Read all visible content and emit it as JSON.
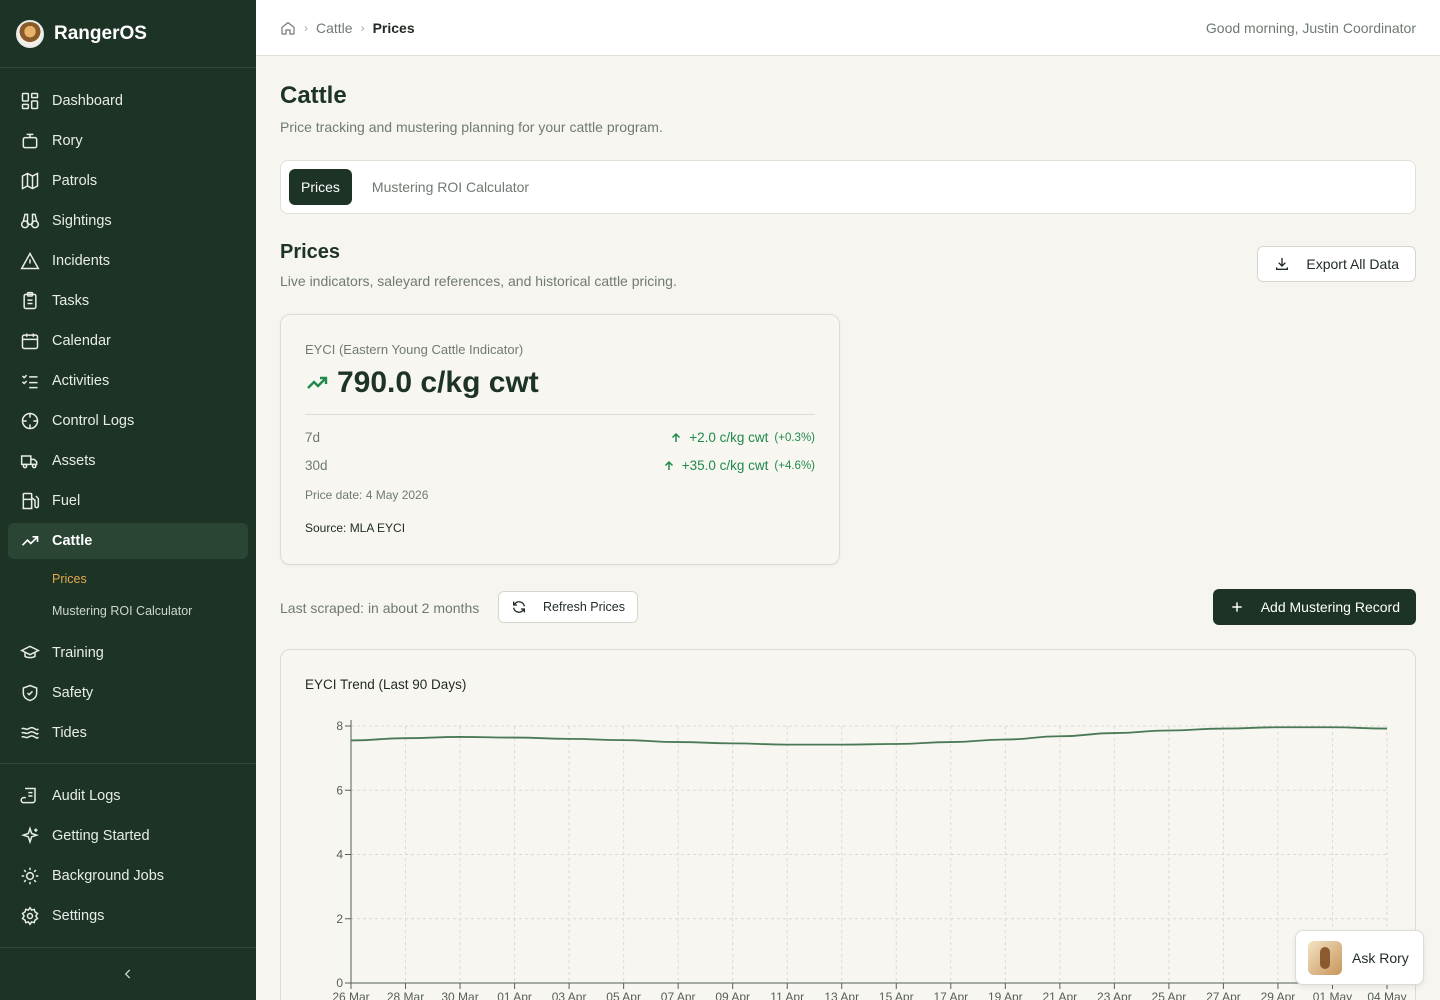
{
  "app": {
    "name": "RangerOS"
  },
  "nav": {
    "items": [
      {
        "label": "Dashboard",
        "icon": "dashboard-icon"
      },
      {
        "label": "Rory",
        "icon": "bot-icon"
      },
      {
        "label": "Patrols",
        "icon": "map-icon"
      },
      {
        "label": "Sightings",
        "icon": "binoculars-icon"
      },
      {
        "label": "Incidents",
        "icon": "alert-triangle-icon"
      },
      {
        "label": "Tasks",
        "icon": "clipboard-icon"
      },
      {
        "label": "Calendar",
        "icon": "calendar-icon"
      },
      {
        "label": "Activities",
        "icon": "list-checks-icon"
      },
      {
        "label": "Control Logs",
        "icon": "crosshair-icon"
      },
      {
        "label": "Assets",
        "icon": "truck-icon"
      },
      {
        "label": "Fuel",
        "icon": "fuel-icon"
      },
      {
        "label": "Cattle",
        "icon": "trending-up-icon",
        "active": true
      }
    ],
    "cattle_sub": [
      "Prices",
      "Mustering ROI Calculator"
    ],
    "items_after": [
      {
        "label": "Training",
        "icon": "graduation-cap-icon"
      },
      {
        "label": "Safety",
        "icon": "shield-check-icon"
      },
      {
        "label": "Tides",
        "icon": "waves-icon"
      }
    ],
    "admin": [
      {
        "label": "Audit Logs",
        "icon": "scroll-icon"
      },
      {
        "label": "Getting Started",
        "icon": "sparkles-icon"
      },
      {
        "label": "Background Jobs",
        "icon": "cog-icon"
      },
      {
        "label": "Settings",
        "icon": "settings-icon"
      }
    ]
  },
  "topbar": {
    "breadcrumb": [
      "Cattle",
      "Prices"
    ],
    "greeting": "Good morning, Justin Coordinator"
  },
  "page": {
    "title": "Cattle",
    "subtitle": "Price tracking and mustering planning for your cattle program.",
    "tabs": [
      {
        "label": "Prices",
        "active": true
      },
      {
        "label": "Mustering ROI Calculator",
        "active": false
      }
    ]
  },
  "prices": {
    "title": "Prices",
    "subtitle": "Live indicators, saleyard references, and historical cattle pricing.",
    "export_label": "Export All Data",
    "card": {
      "label": "EYCI (Eastern Young Cattle Indicator)",
      "value": "790.0 c/kg cwt",
      "rows": [
        {
          "period": "7d",
          "delta": "+2.0 c/kg cwt",
          "pct": "(+0.3%)"
        },
        {
          "period": "30d",
          "delta": "+35.0 c/kg cwt",
          "pct": "(+4.6%)"
        }
      ],
      "price_date": "Price date: 4 May 2026",
      "source": "Source: MLA EYCI"
    },
    "last_scraped": "Last scraped: in about 2 months",
    "refresh_label": "Refresh Prices",
    "add_label": "Add Mustering Record"
  },
  "chart_data": {
    "type": "line",
    "title": "EYCI Trend (Last 90 Days)",
    "xlabel": "",
    "ylabel": "",
    "ylim": [
      0,
      8
    ],
    "yticks": [
      0,
      2,
      4,
      6,
      8
    ],
    "grid": true,
    "x": [
      "26 Mar",
      "28 Mar",
      "30 Mar",
      "01 Apr",
      "03 Apr",
      "05 Apr",
      "07 Apr",
      "09 Apr",
      "11 Apr",
      "13 Apr",
      "15 Apr",
      "17 Apr",
      "19 Apr",
      "21 Apr",
      "23 Apr",
      "25 Apr",
      "27 Apr",
      "29 Apr",
      "01 May",
      "04 May"
    ],
    "series": [
      {
        "values": [
          7.55,
          7.62,
          7.66,
          7.64,
          7.6,
          7.56,
          7.5,
          7.46,
          7.42,
          7.42,
          7.44,
          7.5,
          7.58,
          7.68,
          7.78,
          7.86,
          7.92,
          7.96,
          7.96,
          7.92
        ]
      }
    ],
    "line_color": "#4a7a55"
  },
  "ask_rory": {
    "label": "Ask Rory"
  },
  "colors": {
    "sidebar": "#1d3326",
    "accent": "#e2a84a",
    "positive": "#1f8a4c"
  }
}
